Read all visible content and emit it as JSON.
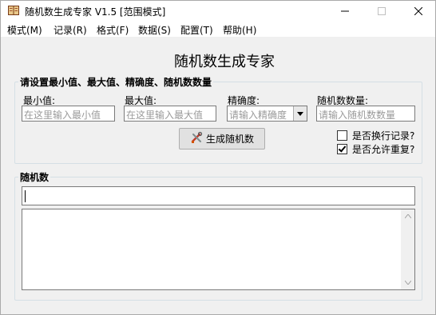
{
  "window": {
    "title": "随机数生成专家 V1.5 [范围模式]"
  },
  "menubar": {
    "items": [
      {
        "label": "模式(M)"
      },
      {
        "label": "记录(R)"
      },
      {
        "label": "格式(F)"
      },
      {
        "label": "数据(S)"
      },
      {
        "label": "配置(T)"
      },
      {
        "label": "帮助(H)"
      }
    ]
  },
  "header": {
    "title": "随机数生成专家"
  },
  "settings": {
    "legend": "请设置最小值、最大值、精确度、随机数数量",
    "min": {
      "label": "最小值:",
      "placeholder": "在这里输入最小值",
      "value": ""
    },
    "max": {
      "label": "最大值:",
      "placeholder": "在这里输入最大值",
      "value": ""
    },
    "precision": {
      "label": "精确度:",
      "placeholder": "请输入精确度"
    },
    "count": {
      "label": "随机数数量:",
      "placeholder": "请输入随机数数量",
      "value": ""
    },
    "generate_label": "生成随机数",
    "newline_record": {
      "label": "是否换行记录?",
      "checked": false
    },
    "allow_repeat": {
      "label": "是否允许重复?",
      "checked": true
    }
  },
  "result": {
    "legend": "随机数",
    "value": "",
    "output": ""
  },
  "icons": {
    "app": "book-icon",
    "generate": "tools-icon"
  },
  "colors": {
    "window_bg": "#f0f0f0",
    "group_border": "#d5dfe5",
    "input_border": "#7a7a7a",
    "placeholder": "#9a9a9a",
    "button_bg": "#e1e1e1"
  }
}
